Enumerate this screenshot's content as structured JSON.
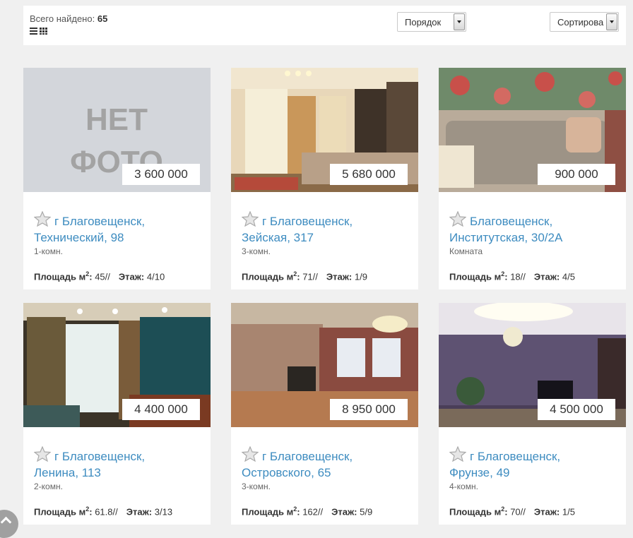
{
  "header": {
    "found_label": "Всего найдено:",
    "found_count": "65",
    "order_select": "Порядок",
    "sort_select": "Сортирова"
  },
  "listings": [
    {
      "price": "3 600 000",
      "title_line1": "г Благовещенск,",
      "title_line2": "Технический, 98",
      "rooms": "1-комн.",
      "area_label": "Площадь м",
      "area": "45//",
      "floor_label": "Этаж:",
      "floor": "4/10",
      "photo": "no-photo",
      "no_photo_text_1": "НЕТ",
      "no_photo_text_2": "ФОТО"
    },
    {
      "price": "5 680 000",
      "title_line1": "г Благовещенск,",
      "title_line2": "Зейская, 317",
      "rooms": "3-комн.",
      "area_label": "Площадь м",
      "area": "71//",
      "floor_label": "Этаж:",
      "floor": "1/9",
      "photo": "living-room-curtains"
    },
    {
      "price": "900 000",
      "title_line1": "Благовещенск,",
      "title_line2": "Институтская, 30/2А",
      "rooms": "Комната",
      "area_label": "Площадь м",
      "area": "18//",
      "floor_label": "Этаж:",
      "floor": "4/5",
      "photo": "sofa-floral-wall"
    },
    {
      "price": "4 400 000",
      "title_line1": "г Благовещенск,",
      "title_line2": "Ленина, 113",
      "rooms": "2-комн.",
      "area_label": "Площадь м",
      "area": "61.8//",
      "floor_label": "Этаж:",
      "floor": "3/13",
      "photo": "room-green-wallpaper"
    },
    {
      "price": "8 950 000",
      "title_line1": "г Благовещенск,",
      "title_line2": "Островского, 65",
      "rooms": "3-комн.",
      "area_label": "Площадь м",
      "area": "162//",
      "floor_label": "Этаж:",
      "floor": "5/9",
      "photo": "large-hall-chandelier"
    },
    {
      "price": "4 500 000",
      "title_line1": "г Благовещенск,",
      "title_line2": "Фрунзе, 49",
      "rooms": "4-комн.",
      "area_label": "Площадь м",
      "area": "70//",
      "floor_label": "Этаж:",
      "floor": "1/5",
      "photo": "purple-room-chandelier"
    }
  ],
  "icons": {
    "list_view": "list-view-icon",
    "grid_view": "grid-view-icon",
    "favorite": "star-icon",
    "scroll_up": "chevron-up-icon"
  }
}
